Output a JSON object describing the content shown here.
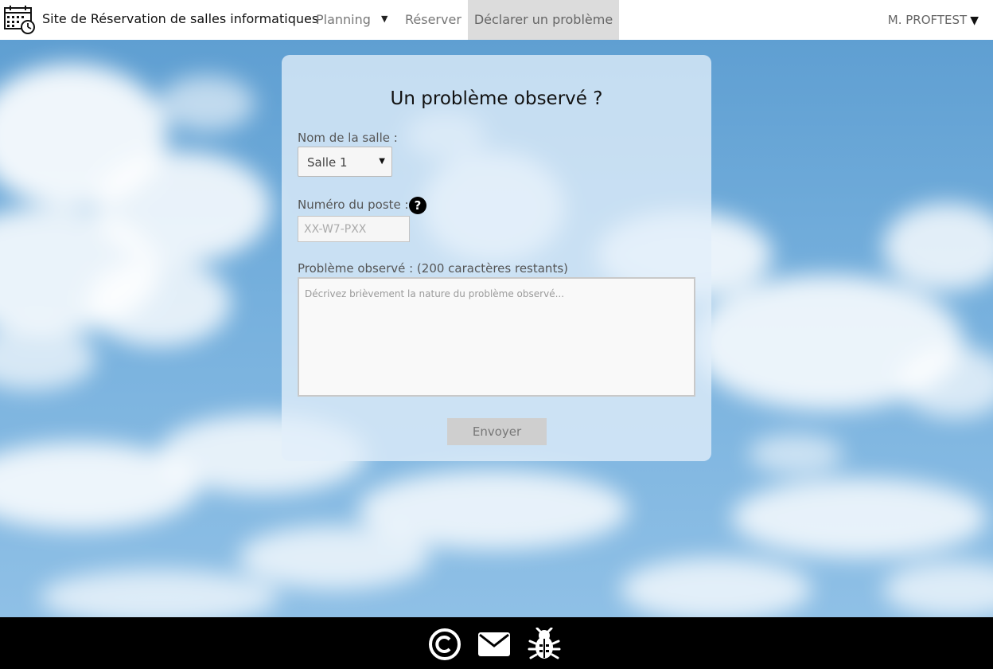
{
  "header": {
    "app_title": "Site de Réservation de salles informatiques",
    "nav": {
      "planning": "Planning",
      "planning_caret": "▼",
      "reserver": "Réserver",
      "declarer": "Déclarer un problème"
    },
    "user": {
      "name": "M. PROFTEST",
      "caret": "▼"
    }
  },
  "form": {
    "title": "Un problème observé ?",
    "salle_label": "Nom de la salle :",
    "salle_value": "Salle 1",
    "salle_caret": "▼",
    "poste_label": "Numéro du poste :",
    "poste_help": "?",
    "poste_placeholder": "XX-W7-PXX",
    "probleme_label": "Problème observé : (200 caractères restants)",
    "probleme_placeholder": "Décrivez brièvement la nature du problème observé...",
    "submit_label": "Envoyer"
  },
  "footer": {
    "icons": [
      "copyright-icon",
      "mail-icon",
      "bug-icon"
    ]
  },
  "colors": {
    "topbar_bg": "#ffffff",
    "active_nav_bg": "#dcdcdc",
    "sky": "#76b0dd",
    "card_bg": "#e1eefa",
    "footer_bg": "#000000",
    "button_bg": "#cfcfcf"
  }
}
